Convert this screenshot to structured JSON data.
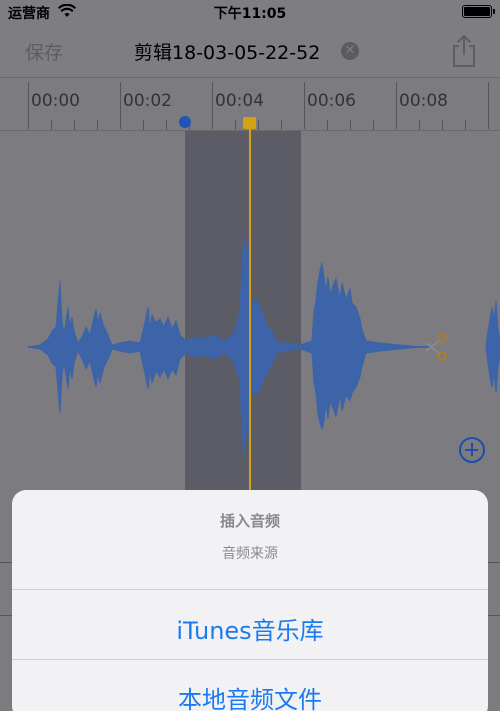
{
  "status_bar": {
    "carrier": "运营商",
    "time": "下午11:05"
  },
  "nav": {
    "save_label": "保存",
    "title": "剪辑18-03-05-22-52",
    "clear_glyph": "✕"
  },
  "timeline": {
    "ticks": [
      "00:00",
      "00:02",
      "00:04",
      "00:06",
      "00:08"
    ]
  },
  "action_sheet": {
    "title": "插入音频",
    "message": "音频来源",
    "actions": [
      "iTunes音乐库",
      "本地音频文件"
    ]
  },
  "icons": {
    "wifi": "wifi-icon",
    "battery": "battery-icon",
    "clear": "clear-icon",
    "share": "share-icon",
    "scissors": "scissors-icon",
    "add": "add-circle-icon"
  },
  "colors": {
    "waveform": "#3d63a8",
    "selection": "#5c5c66",
    "playhead": "#d4a315",
    "action_text": "#1a7bf0"
  }
}
